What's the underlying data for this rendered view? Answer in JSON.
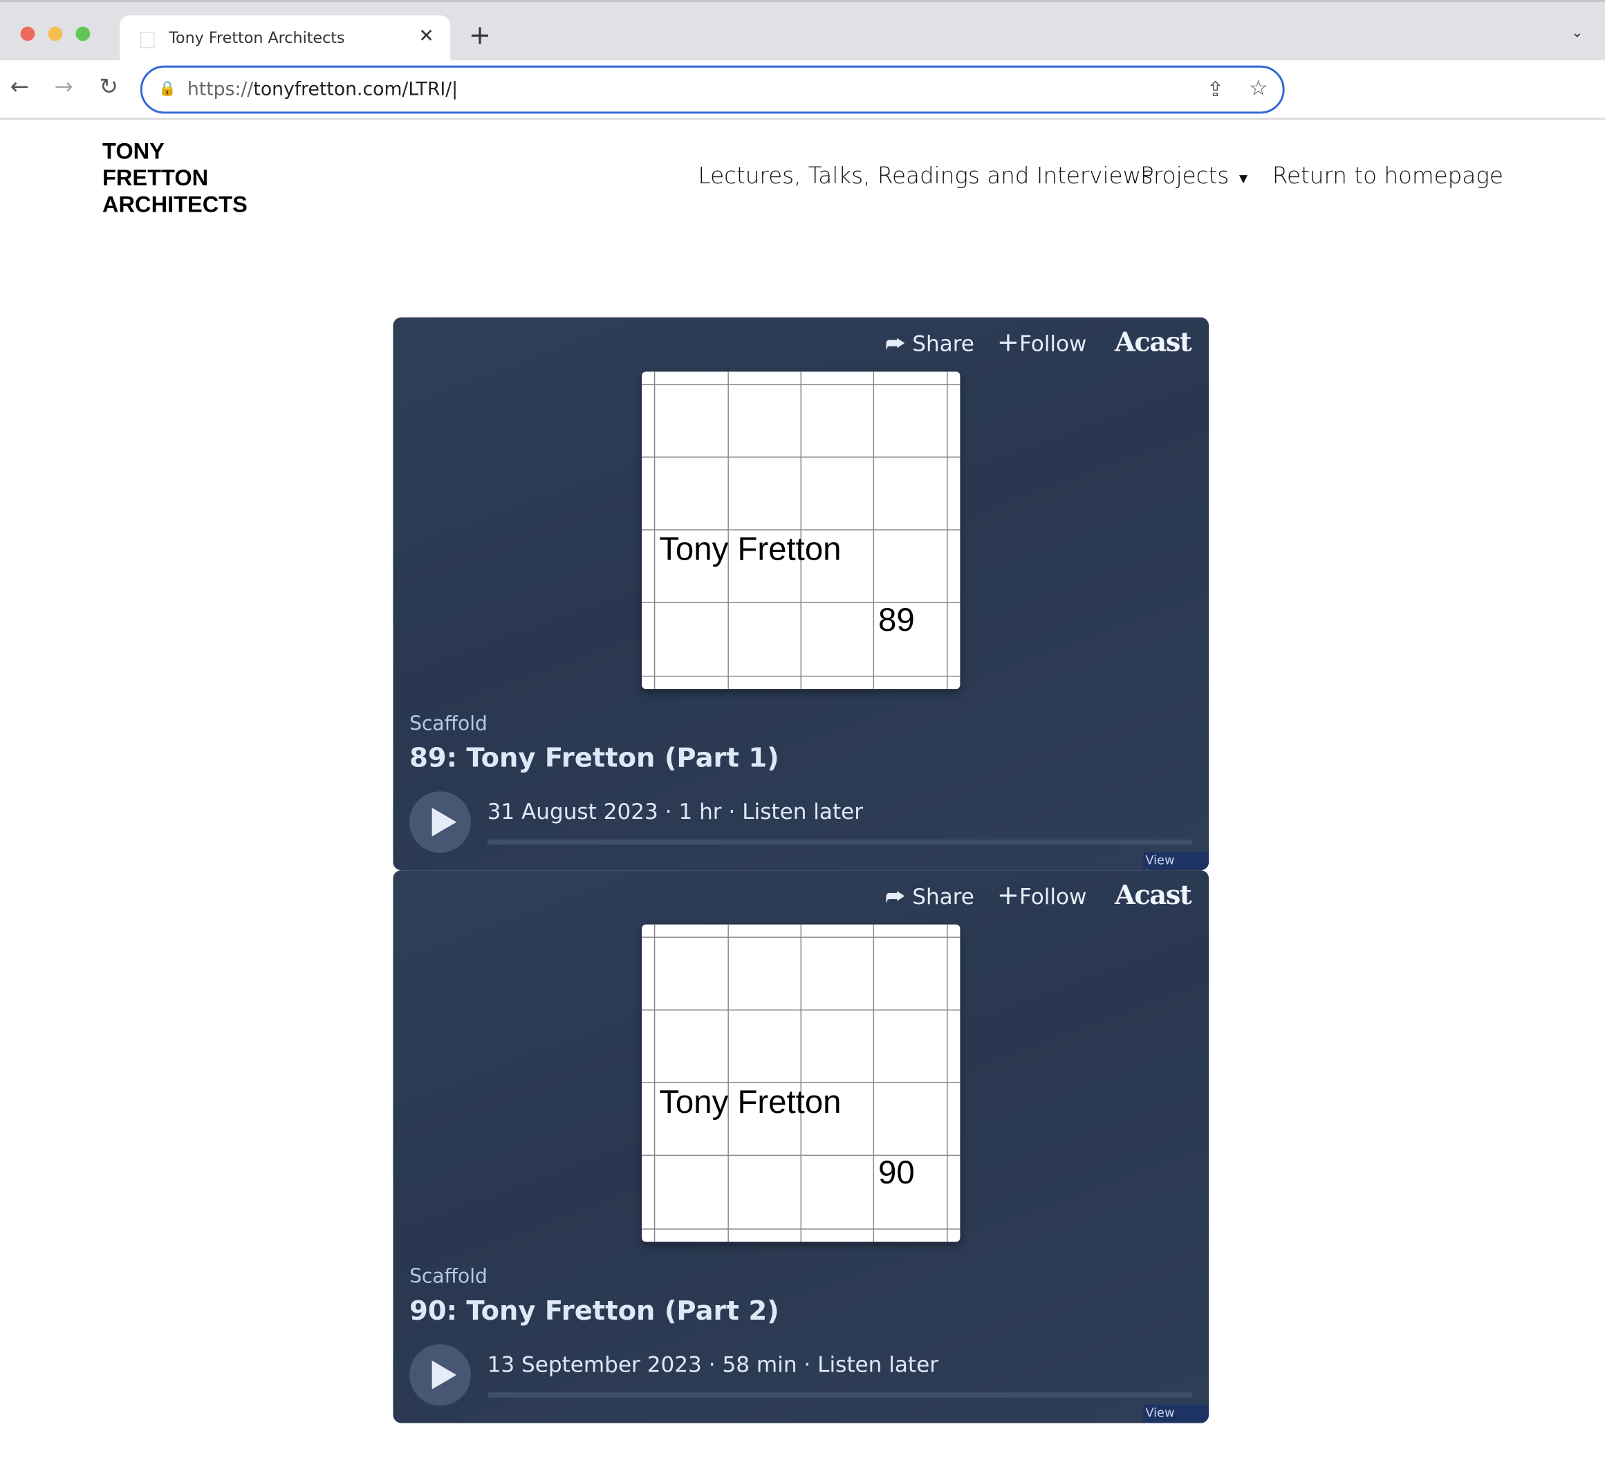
{
  "browser": {
    "tab_title": "Tony Fretton Architects",
    "new_tab": "+",
    "tab_close": "✕",
    "url_scheme": "https://",
    "url_rest": "tonyfretton.com/LTRI/",
    "colors": {
      "focus": "#3367d6",
      "close": "#ed6a5e",
      "minimize": "#f5bf4f",
      "maximize": "#61c554"
    }
  },
  "site": {
    "logo_lines": [
      "TONY",
      "FRETTON",
      "ARCHITECTS"
    ],
    "nav": [
      "Lectures, Talks, Readings and Interviews",
      "Projects",
      "Return to homepage"
    ]
  },
  "episodes": [
    {
      "share": "Share",
      "follow": "Follow",
      "brand": "Acast",
      "art_name": "Tony Fretton",
      "art_number": "89",
      "show": "Scaffold",
      "title": "89: Tony Fretton (Part 1)",
      "date": "31 August 2023",
      "duration": "1 hr",
      "listen_later": "Listen later",
      "view_terms": "View terms",
      "progress": 0
    },
    {
      "share": "Share",
      "follow": "Follow",
      "brand": "Acast",
      "art_name": "Tony Fretton",
      "art_number": "90",
      "show": "Scaffold",
      "title": "90: Tony Fretton (Part 2)",
      "date": "13 September 2023",
      "duration": "58 min",
      "listen_later": "Listen later",
      "view_terms": "View terms",
      "progress": 0
    }
  ]
}
